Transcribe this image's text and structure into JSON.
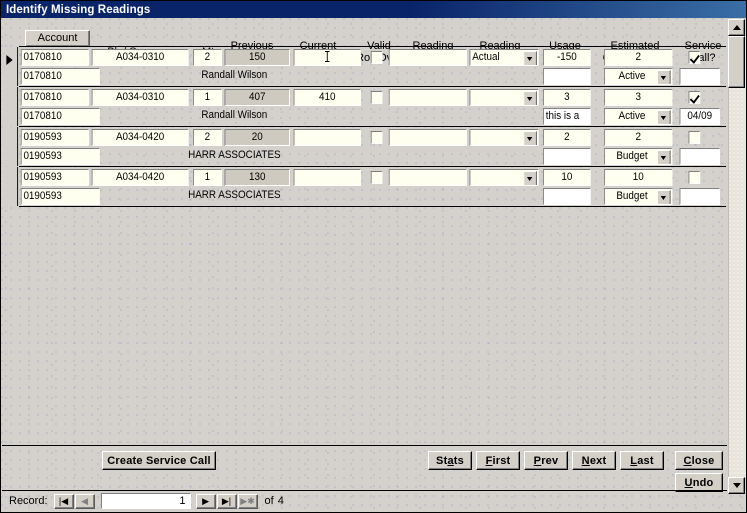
{
  "window": {
    "title": "Identify Missing Readings"
  },
  "columns": {
    "account": "Account",
    "bk_sequence": "Bk / Sequence",
    "mtr": "Mtr",
    "previous_reading": "Previous\nReading",
    "current_reading": "Current\nReading",
    "valid_roll_over": "Valid\nRoll Over",
    "reading_date": "Reading\nDate",
    "reading_type": "Reading\nType",
    "usage_note": "Usage\n/ Note",
    "estimated_consumption": "Estimated\nConsumption",
    "service_call": "Service\nCall?"
  },
  "records": [
    {
      "selected": true,
      "account": "0170810",
      "bk_sequence": "A034-0310",
      "mtr": "2",
      "previous_reading": "150",
      "current_reading": "",
      "current_reading_caret": true,
      "valid_roll_over": false,
      "reading_date": "",
      "reading_type": "Actual",
      "usage": "-150",
      "estimated_consumption": "2",
      "service_call": true,
      "detail_account": "0170810",
      "customer_name": "Randall Wilson",
      "note": "",
      "status": "Active",
      "status_date": ""
    },
    {
      "selected": false,
      "account": "0170810",
      "bk_sequence": "A034-0310",
      "mtr": "1",
      "previous_reading": "407",
      "current_reading": "410",
      "current_reading_caret": false,
      "valid_roll_over": false,
      "reading_date": "",
      "reading_type": "",
      "usage": "3",
      "estimated_consumption": "3",
      "service_call": true,
      "detail_account": "0170810",
      "customer_name": "Randall Wilson",
      "note": "this is a",
      "status": "Active",
      "status_date": "04/09"
    },
    {
      "selected": false,
      "account": "0190593",
      "bk_sequence": "A034-0420",
      "mtr": "2",
      "previous_reading": "20",
      "current_reading": "",
      "current_reading_caret": false,
      "valid_roll_over": false,
      "reading_date": "",
      "reading_type": "",
      "usage": "2",
      "estimated_consumption": "2",
      "service_call": false,
      "detail_account": "0190593",
      "customer_name": "HARR ASSOCIATES",
      "note": "",
      "status": "Budget",
      "status_date": ""
    },
    {
      "selected": false,
      "account": "0190593",
      "bk_sequence": "A034-0420",
      "mtr": "1",
      "previous_reading": "130",
      "current_reading": "",
      "current_reading_caret": false,
      "valid_roll_over": false,
      "reading_date": "",
      "reading_type": "",
      "usage": "10",
      "estimated_consumption": "10",
      "service_call": false,
      "detail_account": "0190593",
      "customer_name": "HARR ASSOCIATES",
      "note": "",
      "status": "Budget",
      "status_date": ""
    }
  ],
  "footer": {
    "create_service_call": "Create Service Call",
    "buttons": [
      {
        "label": "Stats",
        "accel_index": 2
      },
      {
        "label": "First",
        "accel_index": 0
      },
      {
        "label": "Prev",
        "accel_index": 0
      },
      {
        "label": "Next",
        "accel_index": 0
      },
      {
        "label": "Last",
        "accel_index": 0
      },
      {
        "label": "Close",
        "accel_index": 0
      },
      {
        "label": "Undo",
        "accel_index": 0
      }
    ]
  },
  "navigator": {
    "label": "Record:",
    "first_icon": "|◀",
    "prev_icon": "◀",
    "current": "1",
    "next_icon": "▶",
    "last_icon": "▶|",
    "new_icon": "▶✱",
    "of_label": "of",
    "total": "4"
  },
  "colors": {
    "titlebar": "#0a246a",
    "window_face": "#d4d0c8",
    "field_bg": "#fffff0",
    "locked_field_bg": "#cecabf",
    "grid_dot": "#8ca0c8"
  }
}
